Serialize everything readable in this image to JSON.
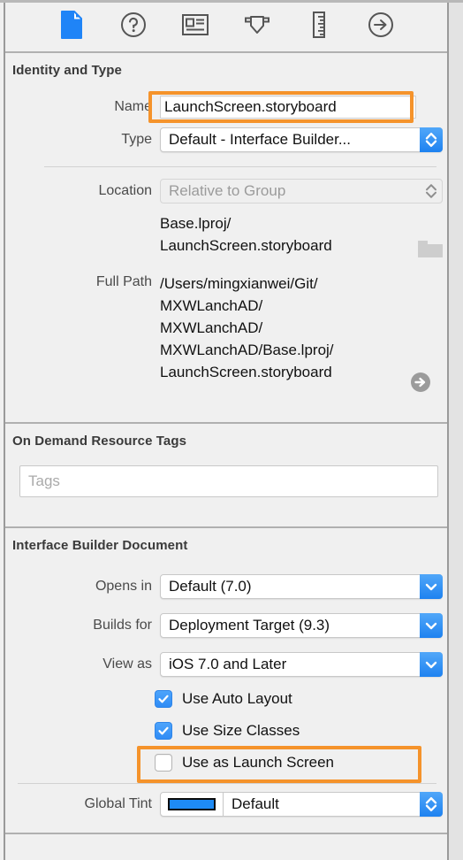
{
  "inspector_toolbar": {
    "buttons": [
      {
        "name": "file-inspector",
        "icon": "document-icon",
        "selected": true
      },
      {
        "name": "quick-help-inspector",
        "icon": "question-circle-icon",
        "selected": false
      },
      {
        "name": "identity-inspector",
        "icon": "identity-card-icon",
        "selected": false
      },
      {
        "name": "attributes-inspector",
        "icon": "attributes-shield-icon",
        "selected": false
      },
      {
        "name": "size-inspector",
        "icon": "ruler-icon",
        "selected": false
      },
      {
        "name": "connections-inspector",
        "icon": "arrow-circle-icon",
        "selected": false
      }
    ]
  },
  "identity_and_type": {
    "title": "Identity and Type",
    "name_label": "Name",
    "name_value": "LaunchScreen.storyboard",
    "type_label": "Type",
    "type_value": "Default - Interface Builder...",
    "location_label": "Location",
    "location_value": "Relative to Group",
    "location_disabled": true,
    "relative_path": "Base.lproj/\nLaunchScreen.storyboard",
    "full_path_label": "Full Path",
    "full_path_value": "/Users/mingxianwei/Git/\nMXWLanchAD/\nMXWLanchAD/\nMXWLanchAD/Base.lproj/\nLaunchScreen.storyboard",
    "folder_icon": "folder-icon",
    "reveal_icon": "arrow-circle-right-icon"
  },
  "on_demand_resource_tags": {
    "title": "On Demand Resource Tags",
    "tags_placeholder": "Tags",
    "tags_value": ""
  },
  "interface_builder_document": {
    "title": "Interface Builder Document",
    "opens_in_label": "Opens in",
    "opens_in_value": "Default (7.0)",
    "builds_for_label": "Builds for",
    "builds_for_value": "Deployment Target (9.3)",
    "view_as_label": "View as",
    "view_as_value": "iOS 7.0 and Later",
    "use_auto_layout_label": "Use Auto Layout",
    "use_auto_layout_checked": true,
    "use_size_classes_label": "Use Size Classes",
    "use_size_classes_checked": true,
    "use_as_launch_screen_label": "Use as Launch Screen",
    "use_as_launch_screen_checked": false,
    "global_tint_label": "Global Tint",
    "global_tint_value": "Default",
    "global_tint_color": "#1e8bf5"
  },
  "colors": {
    "panel_background": "#f0f0f0",
    "accent_blue": "#1e82f0",
    "highlight_orange": "#f5932b",
    "label_gray": "#4a4a4a",
    "disabled_gray": "#9b9b9b"
  },
  "annotations": {
    "highlight_name_row": "Name LaunchScreen.storyboard",
    "highlight_launch_screen_row": "Use as Launch Screen"
  }
}
